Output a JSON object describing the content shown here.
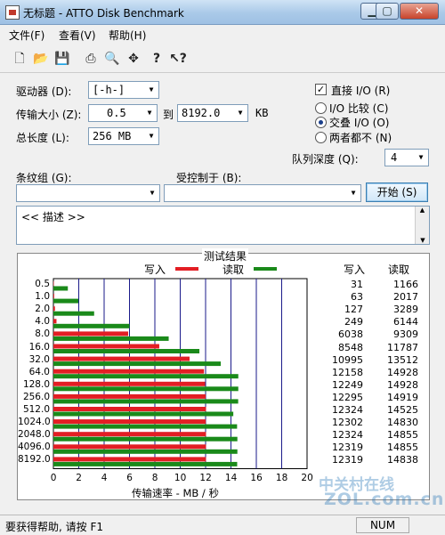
{
  "window": {
    "title": "无标题 - ATTO Disk Benchmark",
    "controls": [
      "minimize-icon",
      "maximize-icon",
      "close-icon"
    ]
  },
  "menu": [
    "文件(F)",
    "查看(V)",
    "帮助(H)"
  ],
  "toolbar": [
    "new-icon",
    "open-icon",
    "save-icon",
    "print-icon",
    "print-preview-icon",
    "move-icon",
    "help-icon",
    "context-help-icon"
  ],
  "form": {
    "drive_label": "驱动器 (D):",
    "drive_value": "[-h-]",
    "transfer_label": "传输大小 (Z):",
    "transfer_from": "0.5",
    "to_label": "到",
    "transfer_to": "8192.0",
    "kb_label": "KB",
    "total_label": "总长度 (L):",
    "total_value": "256 MB",
    "direct_io": "直接 I/O (R)",
    "io_compare": "I/O 比较 (C)",
    "io_overlap": "交叠 I/O (O)",
    "neither": "两者都不 (N)",
    "queue_label": "队列深度 (Q):",
    "queue_value": "4",
    "stripe_label": "条纹组 (G):",
    "controlled_label": "受控制于 (B):",
    "start_button": "开始 (S)",
    "description": "<< 描述 >>"
  },
  "results": {
    "title": "测试结果",
    "write_legend": "写入",
    "read_legend": "读取",
    "write_header": "写入",
    "read_header": "读取",
    "write_color": "#e31e24",
    "read_color": "#1a8a1a",
    "xlabel": "传输速率 - MB / 秒"
  },
  "chart_data": {
    "type": "bar",
    "title": "测试结果",
    "xlabel": "传输速率 - MB / 秒",
    "xlim": [
      0,
      20
    ],
    "xticks": [
      0,
      2,
      4,
      6,
      8,
      10,
      12,
      14,
      16,
      18,
      20
    ],
    "categories": [
      "0.5",
      "1.0",
      "2.0",
      "4.0",
      "8.0",
      "16.0",
      "32.0",
      "64.0",
      "128.0",
      "256.0",
      "512.0",
      "1024.0",
      "2048.0",
      "4096.0",
      "8192.0"
    ],
    "series": [
      {
        "name": "写入",
        "values": [
          31,
          63,
          127,
          249,
          6038,
          8548,
          10995,
          12158,
          12249,
          12295,
          12324,
          12302,
          12324,
          12319,
          12319
        ]
      },
      {
        "name": "读取",
        "values": [
          1166,
          2017,
          3289,
          6144,
          9309,
          11787,
          13512,
          14928,
          14928,
          14919,
          14525,
          14830,
          14855,
          14855,
          14838
        ]
      }
    ]
  },
  "status": {
    "help_text": "要获得帮助, 请按 F1",
    "num": "NUM"
  },
  "watermark": {
    "text_cn": "中关村在线",
    "text_en": "ZOL.com.cn"
  }
}
